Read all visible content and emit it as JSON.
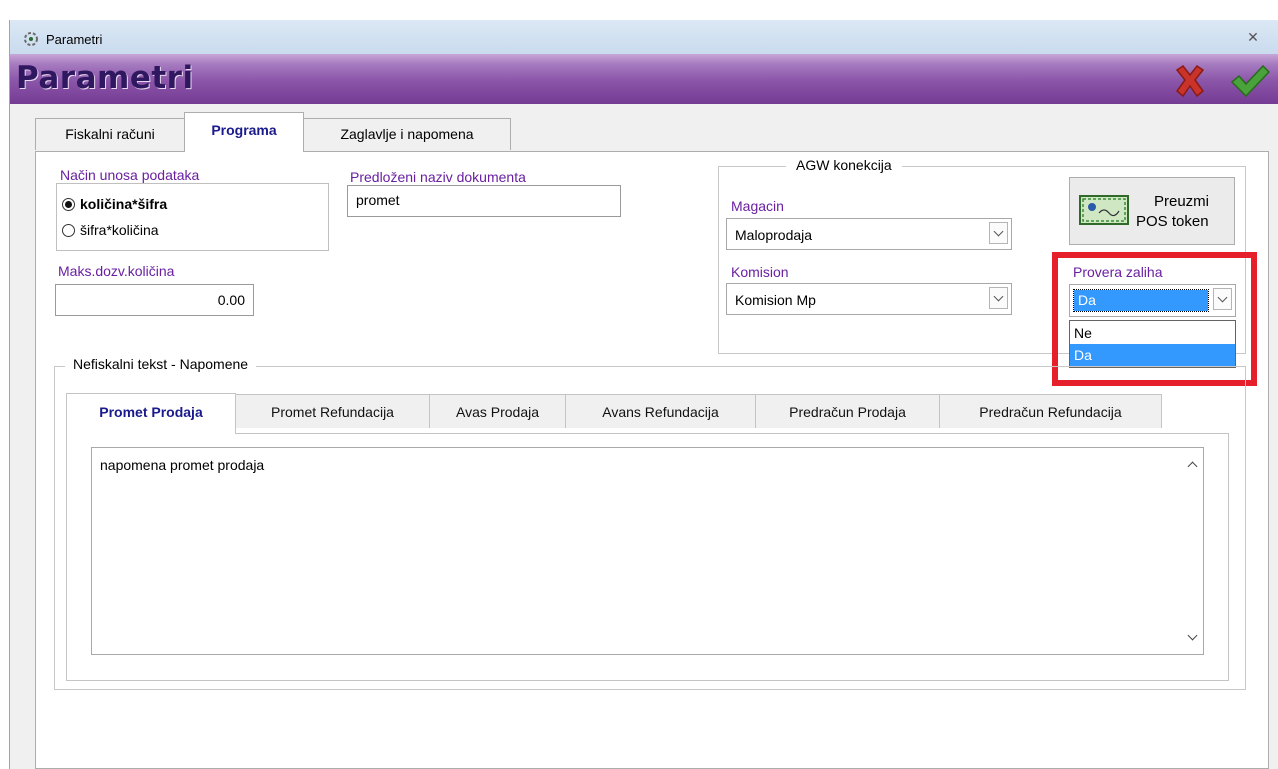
{
  "window": {
    "title": "Parametri",
    "close_label": "✕"
  },
  "header": {
    "title": "Parametri",
    "cancel_icon": "red-x-icon",
    "ok_icon": "green-check-icon"
  },
  "tabs": [
    {
      "label": "Fiskalni računi",
      "active": false
    },
    {
      "label": "Programa",
      "active": true
    },
    {
      "label": "Zaglavlje i napomena",
      "active": false
    }
  ],
  "input_mode": {
    "label": "Način unosa podataka",
    "options": [
      {
        "label": "količina*šifra",
        "selected": true
      },
      {
        "label": "šifra*količina",
        "selected": false
      }
    ]
  },
  "doc_name": {
    "label": "Predloženi naziv dokumenta",
    "value": "promet"
  },
  "max_qty": {
    "label": "Maks.dozv.količina",
    "value": "0.00"
  },
  "agw": {
    "group_label": "AGW konekcija",
    "magacin_label": "Magacin",
    "magacin_value": "Maloprodaja",
    "komision_label": "Komision",
    "komision_value": "Komision Mp",
    "pos_token_label_1": "Preuzmi",
    "pos_token_label_2": "POS token",
    "stock_check_label": "Provera zaliha",
    "stock_check_value": "Da",
    "stock_check_options": [
      {
        "label": "Ne",
        "highlighted": false
      },
      {
        "label": "Da",
        "highlighted": true
      }
    ]
  },
  "notes": {
    "group_label": "Nefiskalni tekst - Napomene",
    "tabs": [
      {
        "label": "Promet Prodaja",
        "active": true
      },
      {
        "label": "Promet Refundacija",
        "active": false
      },
      {
        "label": "Avas Prodaja",
        "active": false
      },
      {
        "label": "Avans Refundacija",
        "active": false
      },
      {
        "label": "Predračun Prodaja",
        "active": false
      },
      {
        "label": "Predračun Refundacija",
        "active": false
      }
    ],
    "text": "napomena promet prodaja"
  },
  "colors": {
    "header_gradient_top": "#c7a6d7",
    "header_gradient_bottom": "#743c93",
    "label_purple": "#6a1fa0",
    "highlight_box": "#e5202a",
    "selection_blue": "#3399ff"
  }
}
